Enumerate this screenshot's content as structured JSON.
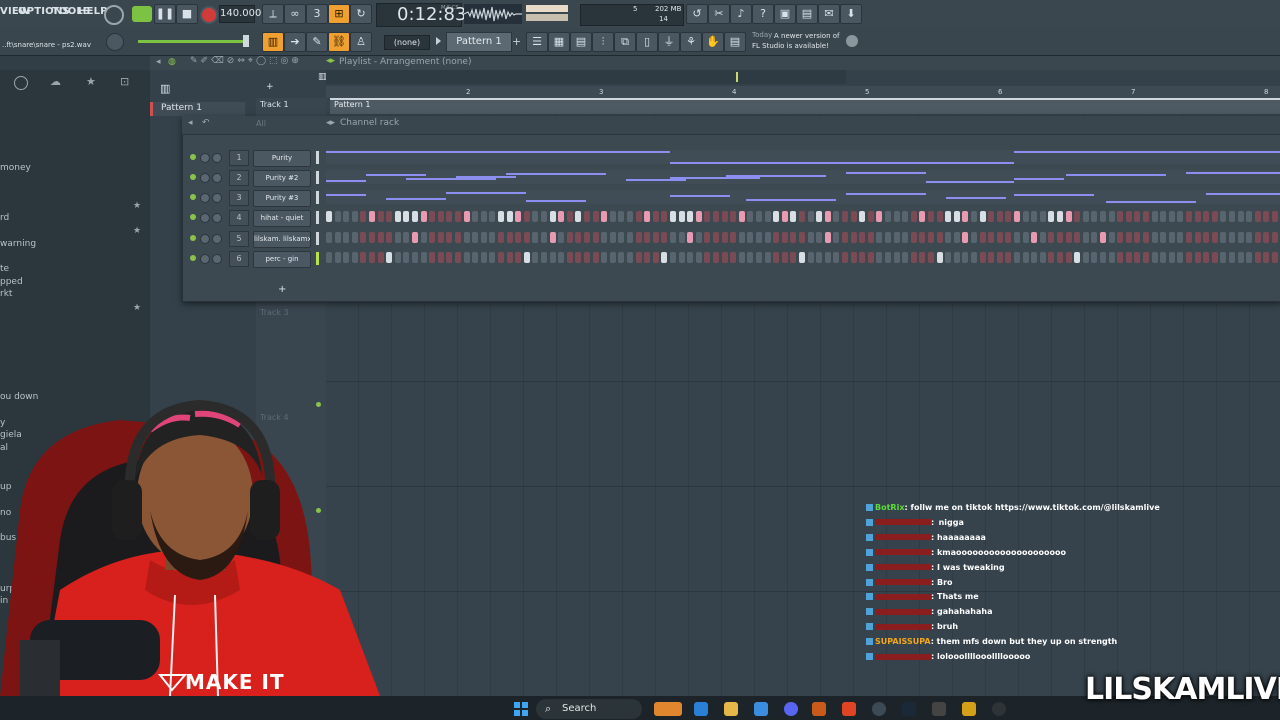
{
  "menu": [
    "VIEW",
    "OPTIONS",
    "TOOLS",
    "HELP"
  ],
  "tempo": "140.000",
  "time": "0:12:83",
  "time_unit": "M:S:CS",
  "cpu_voices": "5",
  "memory": "202 MB",
  "memory_sub": "14",
  "file_name": "..ft\\snare\\snare - ps2.wav",
  "pattern_select": "(none)",
  "pattern_name": "Pattern 1",
  "news": {
    "date": "Today",
    "text": "A newer version of FL Studio is available!"
  },
  "playlist": {
    "title": "Playlist - Arrangement",
    "subtitle": "(none)",
    "ruler": [
      "2",
      "3",
      "4",
      "5",
      "6",
      "7",
      "8"
    ],
    "pattern_clip": "Pattern 1",
    "tracks": [
      "Track 1",
      "Track 3",
      "Track 4"
    ],
    "pattern_in_list": "Pattern 1"
  },
  "browser": {
    "items": [
      "money",
      "rd",
      "warning",
      "te",
      "pped",
      "rkt",
      "ou down",
      "y",
      "giela",
      "al",
      "up",
      "no",
      "bus",
      "urp",
      "in"
    ]
  },
  "rack": {
    "title": "Channel rack",
    "filter": "All",
    "channels": [
      {
        "num": "1",
        "name": "Purity"
      },
      {
        "num": "2",
        "name": "Purity #2"
      },
      {
        "num": "3",
        "name": "Purity #3"
      },
      {
        "num": "4",
        "name": "hihat - quiet"
      },
      {
        "num": "5",
        "name": "lilskam. lilskamx"
      },
      {
        "num": "6",
        "name": "perc - gin"
      }
    ],
    "add_label": "+"
  },
  "chat": [
    {
      "user": "BotRix",
      "user_color": "#5ddb3a",
      "msg": ": follw me on tiktok https://www.tiktok.com/@lilskamlive"
    },
    {
      "user": "",
      "msg": ":  nigga"
    },
    {
      "user": "",
      "msg": ": haaaaaaaa"
    },
    {
      "user": "",
      "msg": ": kmaoooooooooooooooooooo"
    },
    {
      "user": "",
      "msg": ": I was tweaking"
    },
    {
      "user": "",
      "msg": ": Bro"
    },
    {
      "user": "",
      "msg": ": Thats me"
    },
    {
      "user": "",
      "msg": ": gahahahaha"
    },
    {
      "user": "",
      "msg": ": bruh"
    },
    {
      "user": "SUPAISSUPA",
      "user_color": "#f4a61d",
      "msg": ": them mfs down but they up on strength"
    },
    {
      "user": "",
      "msg": ": lolooollllooollllooooo"
    }
  ],
  "taskbar": {
    "search": "Search"
  },
  "webcam_shirt_text": "MAKE IT",
  "watermark": "LILSKAMLIVE"
}
